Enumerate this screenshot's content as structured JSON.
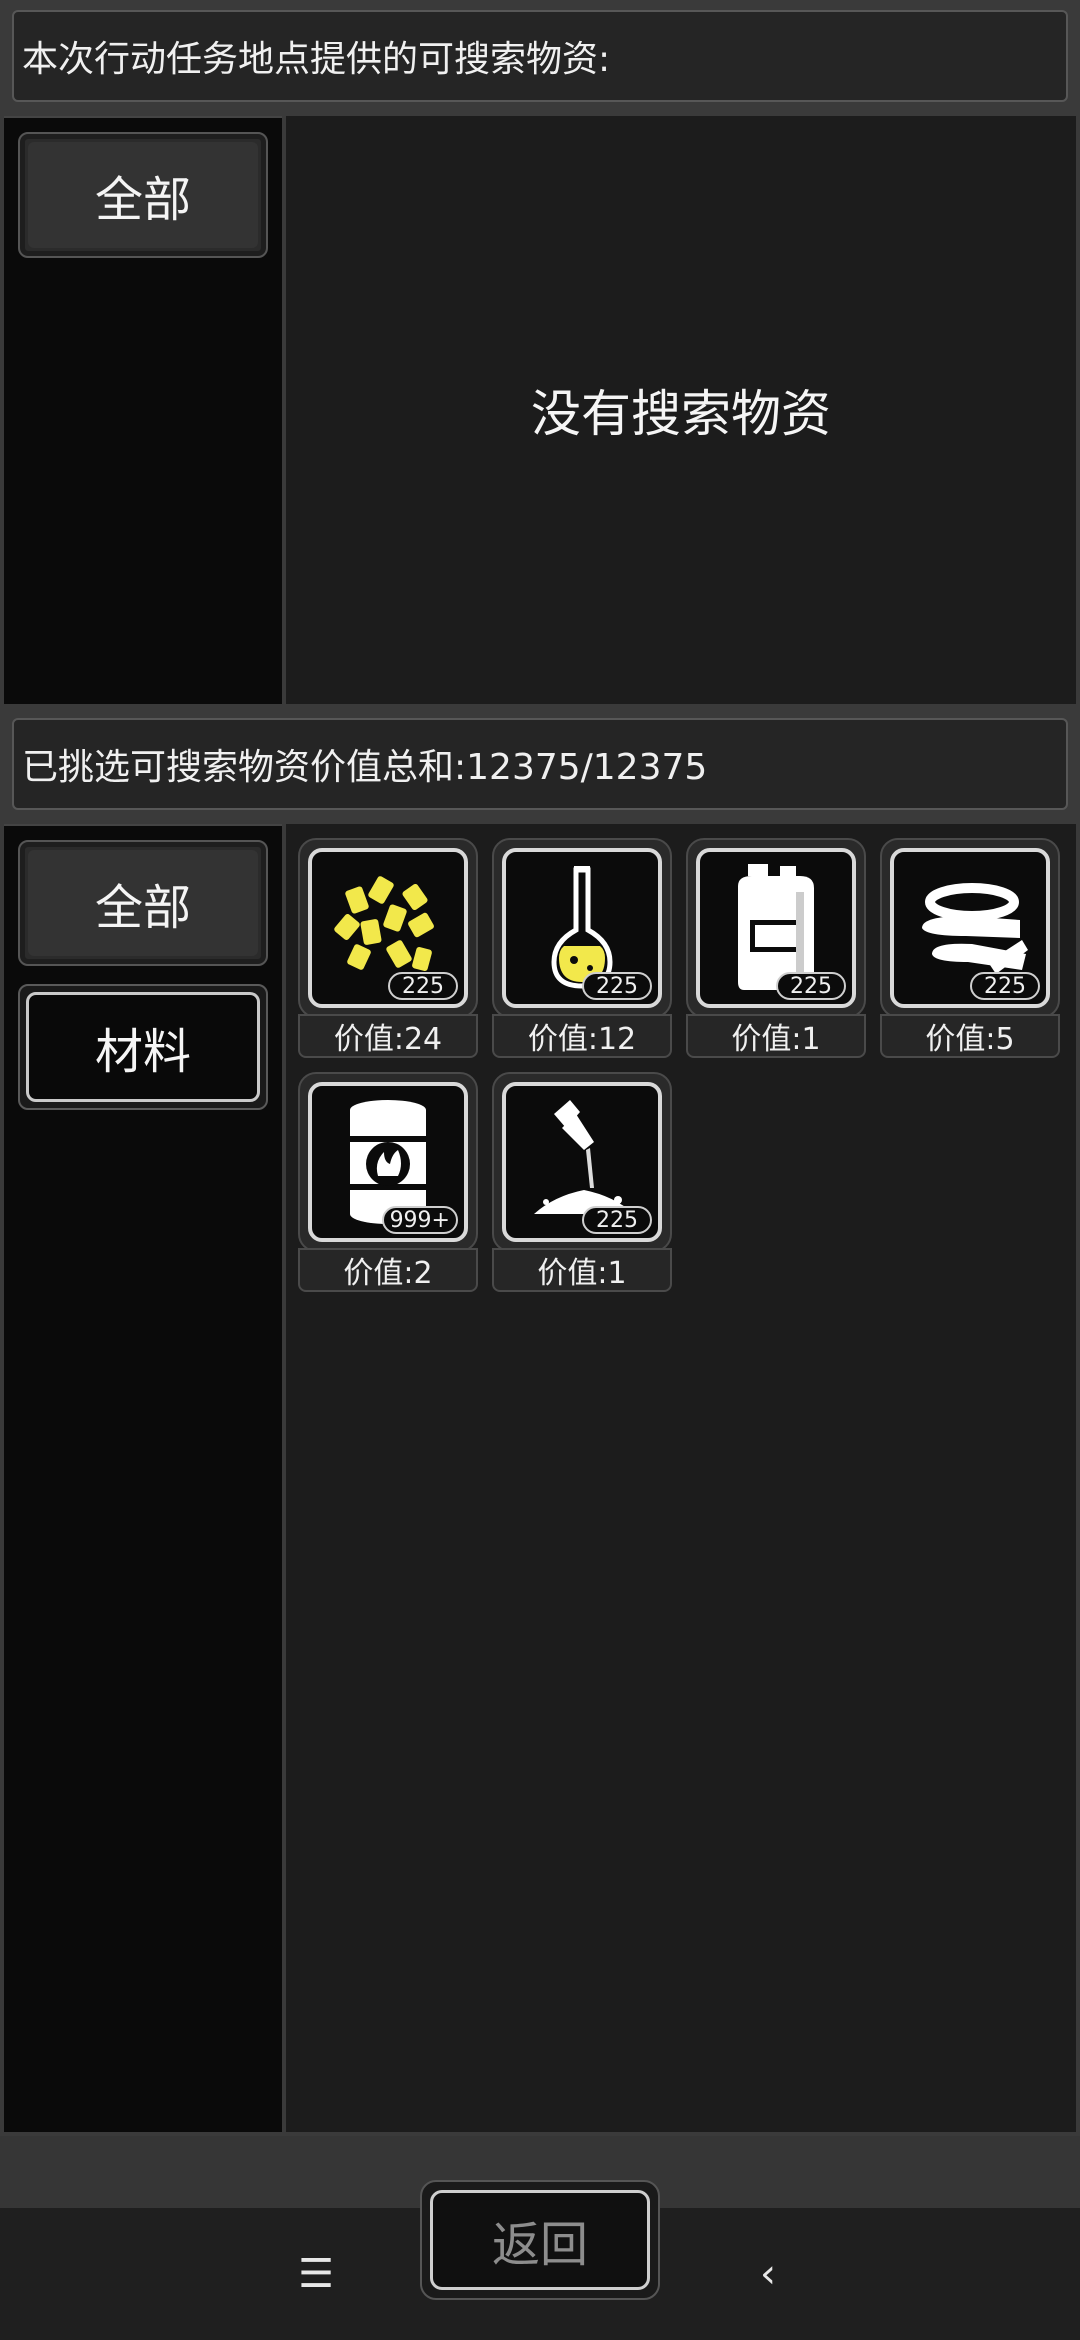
{
  "top_section": {
    "title": "本次行动任务地点提供的可搜索物资:",
    "tabs": [
      {
        "label": "全部"
      }
    ],
    "empty_message": "没有搜索物资"
  },
  "bottom_section": {
    "title": "已挑选可搜索物资价值总和:12375/12375",
    "tabs": [
      {
        "label": "全部"
      },
      {
        "label": "材料"
      }
    ],
    "items": [
      {
        "icon": "yellow-pellets-icon",
        "count": "225",
        "value": "价值:24"
      },
      {
        "icon": "flask-icon",
        "count": "225",
        "value": "价值:12"
      },
      {
        "icon": "jerrycan-icon",
        "count": "225",
        "value": "价值:1"
      },
      {
        "icon": "tape-rolls-icon",
        "count": "225",
        "value": "价值:5"
      },
      {
        "icon": "flammable-barrel-icon",
        "count": "999+",
        "value": "价值:2"
      },
      {
        "icon": "powder-pour-icon",
        "count": "225",
        "value": "价值:1"
      }
    ]
  },
  "footer": {
    "back_label": "返回"
  },
  "colors": {
    "accent_yellow": "#f2e84b",
    "panel_bg": "#1c1c1c",
    "frame": "#3a3a3a"
  }
}
